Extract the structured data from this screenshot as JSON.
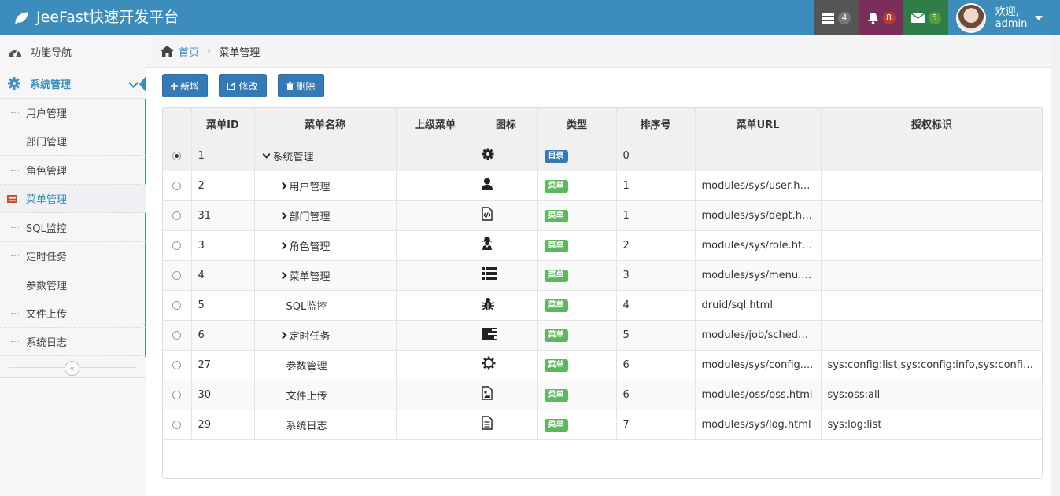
{
  "header": {
    "brand": "JeeFast快速开发平台",
    "tasks_count": "4",
    "notifications_count": "8",
    "messages_count": "5",
    "welcome": "欢迎,",
    "username": "admin"
  },
  "sidebar": {
    "nav_label": "功能导航",
    "system_label": "系统管理",
    "items": [
      {
        "label": "用户管理"
      },
      {
        "label": "部门管理"
      },
      {
        "label": "角色管理"
      },
      {
        "label": "菜单管理"
      },
      {
        "label": "SQL监控"
      },
      {
        "label": "定时任务"
      },
      {
        "label": "参数管理"
      },
      {
        "label": "文件上传"
      },
      {
        "label": "系统日志"
      }
    ],
    "active_item": "菜单管理"
  },
  "breadcrumb": {
    "home": "首页",
    "current": "菜单管理"
  },
  "toolbar": {
    "add_label": "新增",
    "edit_label": "修改",
    "delete_label": "删除"
  },
  "table": {
    "columns": [
      "菜单ID",
      "菜单名称",
      "上级菜单",
      "图标",
      "类型",
      "排序号",
      "菜单URL",
      "授权标识"
    ],
    "rows": [
      {
        "id": "1",
        "name": "系统管理",
        "parent": "",
        "icon": "gear-icon",
        "type": "目录",
        "order": "0",
        "url": "",
        "perms": ""
      },
      {
        "id": "2",
        "name": "用户管理",
        "parent": "",
        "icon": "user-icon",
        "type": "菜单",
        "order": "1",
        "url": "modules/sys/user.html",
        "perms": ""
      },
      {
        "id": "31",
        "name": "部门管理",
        "parent": "",
        "icon": "file-code-icon",
        "type": "菜单",
        "order": "1",
        "url": "modules/sys/dept.html",
        "perms": ""
      },
      {
        "id": "3",
        "name": "角色管理",
        "parent": "",
        "icon": "user-secret-icon",
        "type": "菜单",
        "order": "2",
        "url": "modules/sys/role.html",
        "perms": ""
      },
      {
        "id": "4",
        "name": "菜单管理",
        "parent": "",
        "icon": "list-icon",
        "type": "菜单",
        "order": "3",
        "url": "modules/sys/menu.h...",
        "perms": ""
      },
      {
        "id": "5",
        "name": "SQL监控",
        "parent": "",
        "icon": "bug-icon",
        "type": "菜单",
        "order": "4",
        "url": "druid/sql.html",
        "perms": ""
      },
      {
        "id": "6",
        "name": "定时任务",
        "parent": "",
        "icon": "tasks-icon",
        "type": "菜单",
        "order": "5",
        "url": "modules/job/schedul...",
        "perms": ""
      },
      {
        "id": "27",
        "name": "参数管理",
        "parent": "",
        "icon": "cog-outline-icon",
        "type": "菜单",
        "order": "6",
        "url": "modules/sys/config....",
        "perms": "sys:config:list,sys:config:info,sys:config:..."
      },
      {
        "id": "30",
        "name": "文件上传",
        "parent": "",
        "icon": "file-image-icon",
        "type": "菜单",
        "order": "6",
        "url": "modules/oss/oss.html",
        "perms": "sys:oss:all"
      },
      {
        "id": "29",
        "name": "系统日志",
        "parent": "",
        "icon": "file-text-icon",
        "type": "菜单",
        "order": "7",
        "url": "modules/sys/log.html",
        "perms": "sys:log:list"
      }
    ]
  },
  "colors": {
    "header": "#3c8dbc",
    "tag_directory": "#337ab7",
    "tag_menu": "#5cb85c",
    "button": "#337ab7"
  }
}
